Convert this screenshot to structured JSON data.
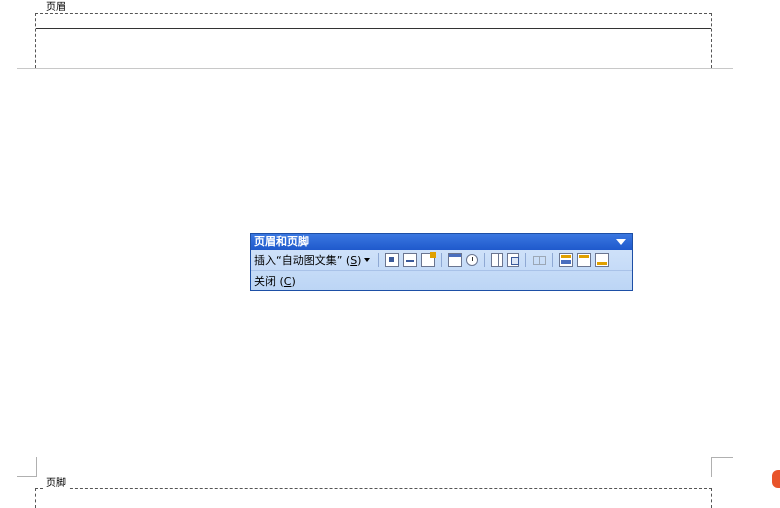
{
  "header_area": {
    "label": "页眉"
  },
  "footer_area": {
    "label": "页脚"
  },
  "toolbar": {
    "title": "页眉和页脚",
    "insert_autotext": {
      "prefix": "插入“自动图文集” (",
      "accesskey": "S",
      "suffix": ")"
    },
    "close": {
      "prefix": "关闭 (",
      "accesskey": "C",
      "suffix": ")"
    },
    "icons": [
      "insert-page-number-icon",
      "insert-page-count-icon",
      "format-page-number-icon",
      "insert-date-icon",
      "insert-time-icon",
      "page-setup-icon",
      "show-hide-document-text-icon",
      "link-to-previous-icon",
      "switch-header-footer-icon",
      "show-previous-icon",
      "show-next-icon"
    ]
  },
  "colors": {
    "titlebar": "#1f59cc",
    "toolbar_bg": "#c9dcf7",
    "border": "#1d4fa6"
  }
}
